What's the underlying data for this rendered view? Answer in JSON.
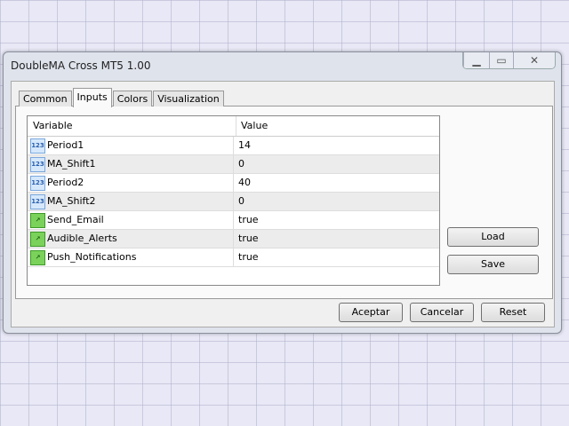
{
  "window": {
    "title": "DoubleMA Cross MT5 1.00"
  },
  "tabs": [
    "Common",
    "Inputs",
    "Colors",
    "Visualization"
  ],
  "table": {
    "headers": [
      "Variable",
      "Value"
    ],
    "rows": [
      {
        "name": "Period1",
        "value": "14",
        "type": "123"
      },
      {
        "name": "MA_Shift1",
        "value": "0",
        "type": "123"
      },
      {
        "name": "Period2",
        "value": "40",
        "type": "123"
      },
      {
        "name": "MA_Shift2",
        "value": "0",
        "type": "123"
      },
      {
        "name": "Send_Email",
        "value": "true",
        "type": "bool"
      },
      {
        "name": "Audible_Alerts",
        "value": "true",
        "type": "bool"
      },
      {
        "name": "Push_Notifications",
        "value": "true",
        "type": "bool"
      }
    ]
  },
  "buttons": {
    "load": "Load",
    "save": "Save",
    "ok": "Aceptar",
    "cancel": "Cancelar",
    "reset": "Reset"
  },
  "icons": {
    "number": "123"
  }
}
